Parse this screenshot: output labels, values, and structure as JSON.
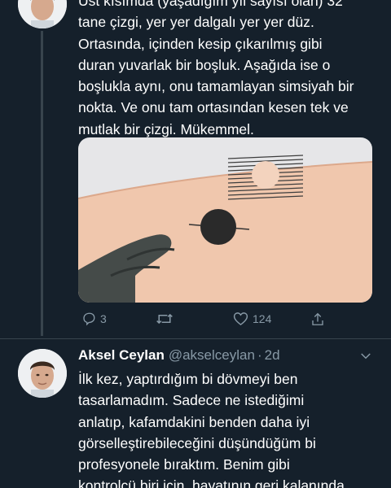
{
  "thread": [
    {
      "text": "Üst kısımda (yaşadığım yıl sayısı olan) 32\ntane çizgi, yer yer dalgalı yer yer düz.\nOrtasında, içinden kesip çıkarılmış gibi\nduran yuvarlak bir boşluk. Aşağıda ise o\nboşlukla aynı, onu tamamlayan simsiyah bir\nnokta. Ve onu tam ortasından kesen tek ve\nmutlak bir çizgi. Mükemmel.",
      "actions": {
        "reply_count": "3",
        "retweet_count": "",
        "like_count": "124"
      }
    },
    {
      "author_name": "Aksel Ceylan",
      "handle": "@akselceylan",
      "separator": "·",
      "time": "2d",
      "text": "İlk kez, yaptırdığım bi dövmeyi ben\ntasarlamadım. Sadece ne istediğimi\nanlatıp, kafamdakini benden daha iyi\ngörselleştirebileceğini düşündüğüm bi\nprofesyonele bıraktım. Benim gibi\nkontrolcü biri için, hayatının geri kalanında"
    }
  ],
  "icons": {
    "reply": "reply-icon",
    "retweet": "retweet-icon",
    "like": "heart-icon",
    "share": "share-icon",
    "more": "chevron-down-icon"
  },
  "colors": {
    "background": "#15202b",
    "text": "#ffffff",
    "secondary": "#8899a6",
    "divider": "#38444d"
  }
}
